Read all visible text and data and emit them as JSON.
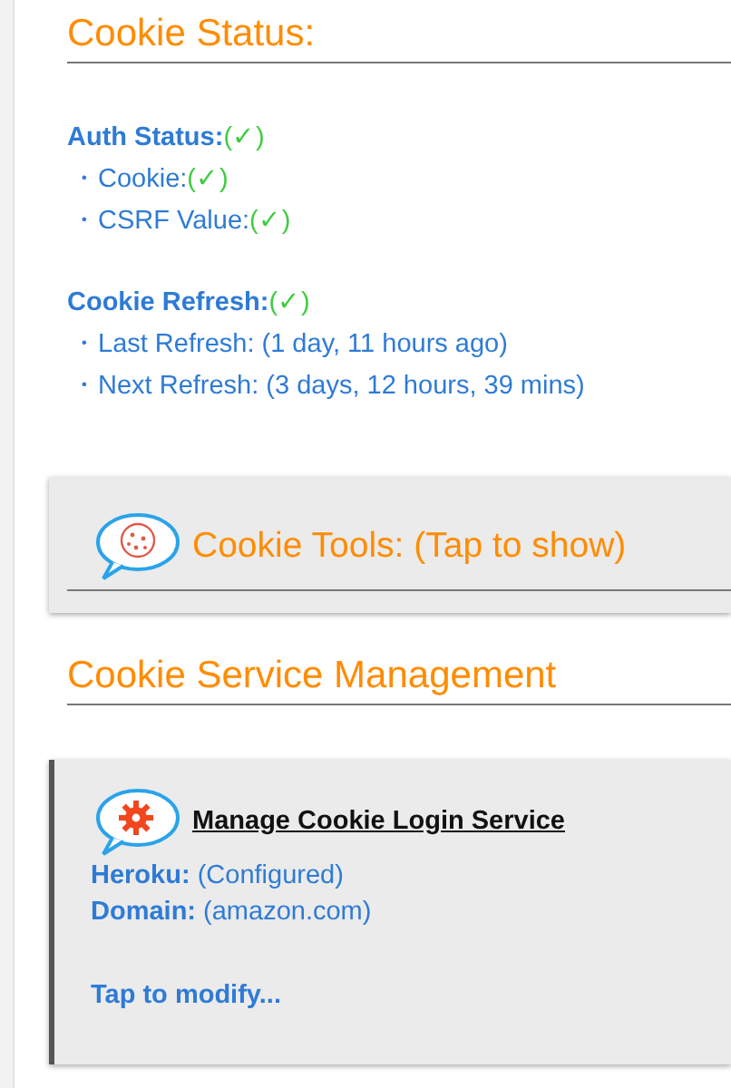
{
  "status_section": {
    "title": "Cookie Status:",
    "groups": [
      {
        "label": "Auth Status:",
        "value": "(✓)",
        "items": [
          {
            "label": "・Cookie:",
            "value": "(✓)"
          },
          {
            "label": "・CSRF Value:",
            "value": "(✓)"
          }
        ]
      },
      {
        "label": "Cookie Refresh:",
        "value": "(✓)",
        "items": [
          {
            "label": "・Last Refresh: (1 day, 11 hours ago)"
          },
          {
            "label": "・Next Refresh: (3 days, 12 hours, 39 mins)"
          }
        ]
      }
    ]
  },
  "tools_card": {
    "title": "Cookie Tools: (Tap to show)"
  },
  "service_section": {
    "title": "Cookie Service Management",
    "card": {
      "title": "Manage Cookie Login Service",
      "fields": [
        {
          "label": "Heroku:",
          "value": "(Configured)"
        },
        {
          "label": "Domain:",
          "value": "(amazon.com)"
        }
      ],
      "action": "Tap to modify..."
    }
  }
}
